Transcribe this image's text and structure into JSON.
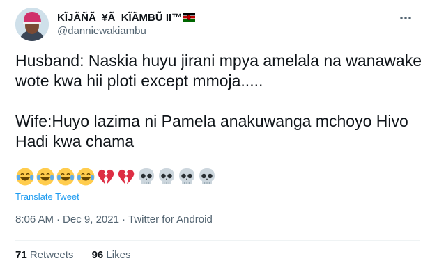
{
  "author": {
    "display_name": "KĨJÃÑÃ_¥Ã_KĨÃMBŨ II™",
    "handle": "@danniewakiambu",
    "flag_icon": "kenya-flag-icon"
  },
  "tweet": {
    "text": "Husband: Naskia huyu jirani mpya amelala na wanawake wote kwa hii ploti except mmoja.....\n\nWife:Huyo lazima ni Pamela anakuwanga mchoyo Hivo Hadi kwa chama",
    "emojis": [
      "joy-icon",
      "joy-icon",
      "joy-icon",
      "joy-icon",
      "broken-heart-icon",
      "broken-heart-icon",
      "skull-icon",
      "skull-icon",
      "skull-icon",
      "skull-icon"
    ],
    "translate_label": "Translate Tweet"
  },
  "meta": {
    "time": "8:06 AM",
    "date": "Dec 9, 2021",
    "source": "Twitter for Android",
    "separator": "·"
  },
  "stats": {
    "retweets_count": "71",
    "retweets_label": "Retweets",
    "likes_count": "96",
    "likes_label": "Likes"
  },
  "colors": {
    "link": "#1d9bf0",
    "secondary": "#536471",
    "text": "#0f1419"
  }
}
